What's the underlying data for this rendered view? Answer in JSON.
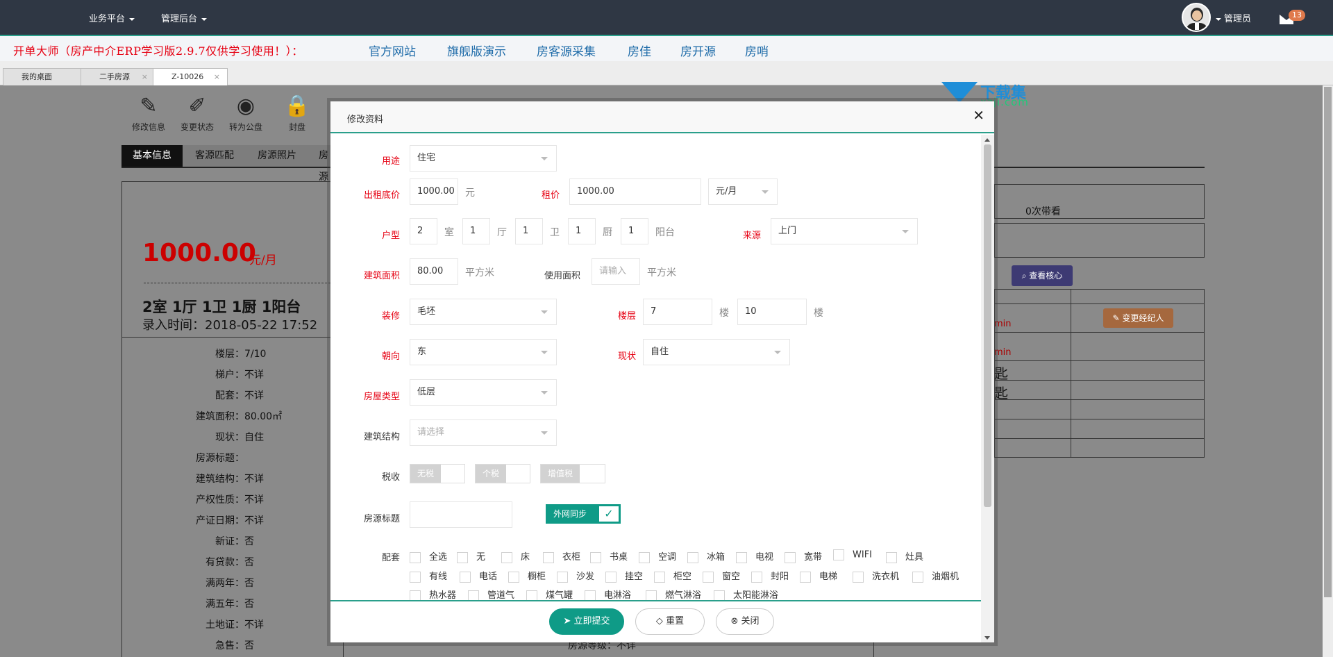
{
  "topnav": {
    "menu1": "业务平台",
    "menu2": "管理后台",
    "user": "管理员",
    "mail_count": "13"
  },
  "banner": {
    "slogan": "开单大师（房产中介ERP学习版2.9.7仅供学习使用！）：",
    "links": [
      "官方网站",
      "旗舰版演示",
      "房客源采集",
      "房佳",
      "房开源",
      "房哨"
    ]
  },
  "tabs": [
    {
      "label": "我的桌面"
    },
    {
      "label": "二手房源"
    },
    {
      "label": "Z-10026"
    }
  ],
  "background": {
    "toolbar": [
      "修改信息",
      "变更状态",
      "转为公盘",
      "封盘"
    ],
    "tabs": [
      "基本信息",
      "客源匹配",
      "房源照片",
      "房源"
    ],
    "price": "1000.00",
    "price_unit": "元/月",
    "room": "2室 1厅 1卫 1厨 1阳台",
    "entry": "录入时间：2018-05-22 17:52",
    "details": [
      {
        "k": "楼层：",
        "v": "7/10"
      },
      {
        "k": "梯户：",
        "v": "不详"
      },
      {
        "k": "配套：",
        "v": "不详"
      },
      {
        "k": "建筑面积：",
        "v": "80.00㎡"
      },
      {
        "k": "现状：",
        "v": "自住"
      },
      {
        "k": "房源标题：",
        "v": ""
      },
      {
        "k": "建筑结构：",
        "v": "不详"
      },
      {
        "k": "产权性质：",
        "v": "不详"
      },
      {
        "k": "产证日期：",
        "v": "不详"
      },
      {
        "k": "新证：",
        "v": "否"
      },
      {
        "k": "有贷款：",
        "v": "否"
      },
      {
        "k": "满两年：",
        "v": "否"
      },
      {
        "k": "满五年：",
        "v": "否"
      },
      {
        "k": "土地证：",
        "v": "不详"
      },
      {
        "k": "急售：",
        "v": "否"
      }
    ],
    "level": "房源等级：不详",
    "viewings": "0次带看",
    "view_core_btn": "查看核心",
    "change_agent_btn": "变更经纪人",
    "admin_frag": "min",
    "key_frag": "匙"
  },
  "watermark": {
    "name": "下载集",
    "domain": "xzji.com"
  },
  "modal": {
    "title": "修改资料",
    "labels": {
      "usage": "用途",
      "rent_floor": "出租底价",
      "rent": "租价",
      "layout": "户型",
      "source": "来源",
      "area": "建筑面积",
      "use_area": "使用面积",
      "decor": "装修",
      "floor": "楼层",
      "orient": "朝向",
      "status": "现状",
      "house_type": "房屋类型",
      "structure": "建筑结构",
      "tax": "税收",
      "title": "房源标题",
      "facilities": "配套"
    },
    "values": {
      "usage": "住宅",
      "rent_floor": "1000.00",
      "rent": "1000.00",
      "rent_unit": "元/月",
      "rooms": "2",
      "halls": "1",
      "baths": "1",
      "kitchens": "1",
      "balconies": "1",
      "source": "上门",
      "area": "80.00",
      "decor": "毛坯",
      "floor": "7",
      "floor_total": "10",
      "orient": "东",
      "status": "自住",
      "house_type": "低层",
      "title": ""
    },
    "placeholders": {
      "use_area": "请输入",
      "structure": "请选择"
    },
    "units": {
      "yuan": "元",
      "shi": "室",
      "ting": "厅",
      "wei": "卫",
      "chu": "厨",
      "yangtai": "阳台",
      "sqm1": "平方米",
      "sqm2": "平方米",
      "lou1": "楼",
      "lou2": "楼"
    },
    "tax_switches": [
      "无税",
      "个税",
      "增值税"
    ],
    "sync_label": "外网同步",
    "facilities": [
      [
        "全选",
        "无",
        "床",
        "衣柜",
        "书桌",
        "空调",
        "冰箱",
        "电视",
        "宽带",
        "WIFI",
        "灶具"
      ],
      [
        "有线",
        "电话",
        "橱柜",
        "沙发",
        "挂空",
        "柜空",
        "窗空",
        "封阳",
        "电梯",
        "洗衣机",
        "油烟机"
      ],
      [
        "热水器",
        "管道气",
        "煤气罐",
        "电淋浴",
        "燃气淋浴",
        "太阳能淋浴"
      ]
    ],
    "buttons": {
      "submit": "立即提交",
      "reset": "重置",
      "close": "关闭"
    }
  }
}
